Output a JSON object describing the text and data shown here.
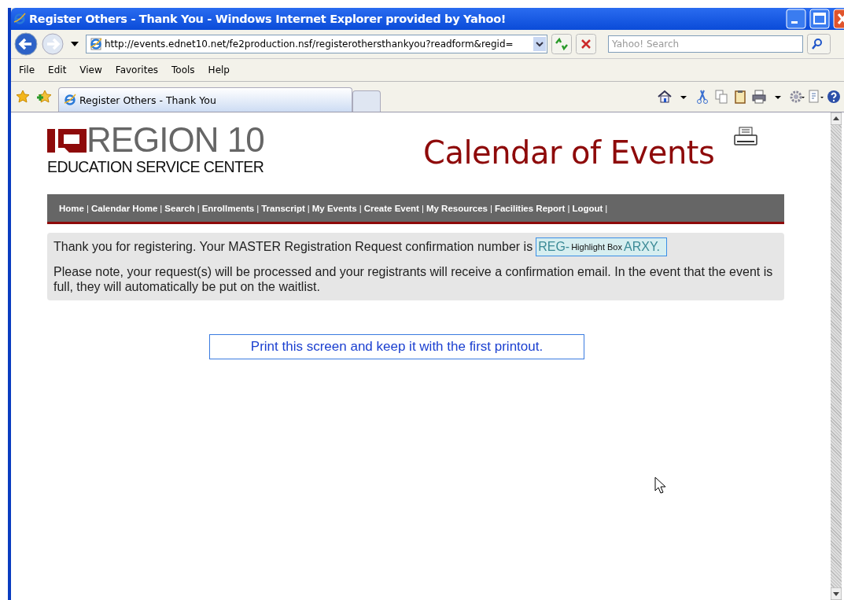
{
  "window": {
    "title": "Register Others - Thank You - Windows Internet Explorer provided by Yahoo!"
  },
  "address_bar": {
    "value": "http://events.ednet10.net/fe2production.nsf/registerothersthankyou?readform&regid="
  },
  "search": {
    "placeholder": "Yahoo! Search"
  },
  "menu": [
    "File",
    "Edit",
    "View",
    "Favorites",
    "Tools",
    "Help"
  ],
  "tabs": [
    {
      "label": "Register Others - Thank You",
      "selected": true
    }
  ],
  "page": {
    "logo_title": "REGION 10",
    "logo_subtitle": "EDUCATION SERVICE CENTER",
    "heading": "Calendar of Events",
    "nav": [
      "Home",
      "Calendar Home",
      "Search",
      "Enrollments",
      "Transcript",
      "My Events",
      "Create Event",
      "My Resources",
      "Facilities Report",
      "Logout"
    ],
    "nav_separator": "|",
    "message": "Thank you for registering. Your MASTER Registration Request confirmation number is",
    "confirmation_start": "REG-",
    "highlight_label": "Highlight Box",
    "confirmation_end": "ARXY.",
    "note": "Please note, your request(s) will be processed and your registrants will receive a confirmation email. In the event that the event is full, they will automatically be put on the waitlist.",
    "print_notice": "Print this screen and keep it with the first printout."
  }
}
